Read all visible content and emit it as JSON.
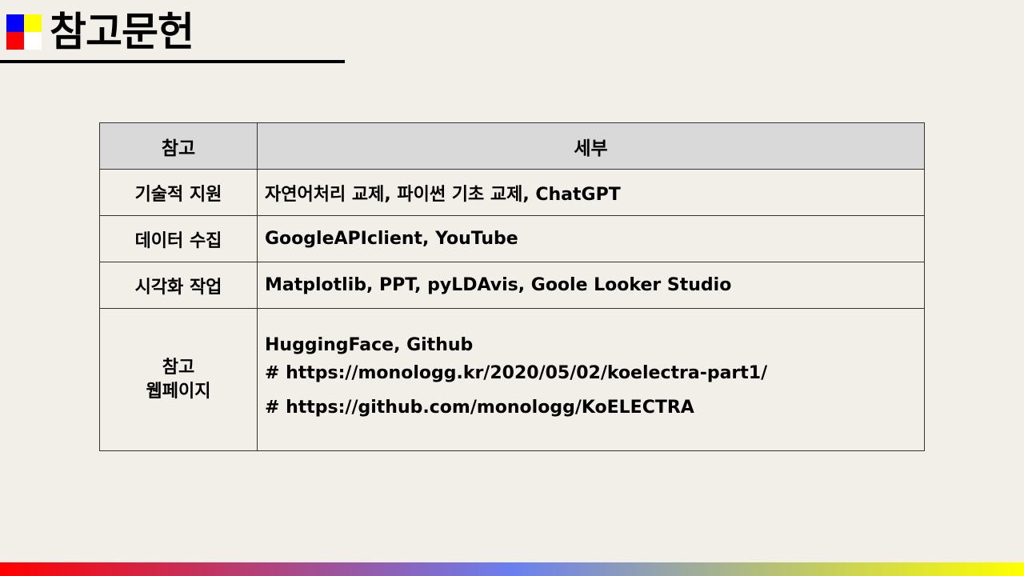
{
  "title": "참고문헌",
  "colors": {
    "background": "#f2efe9",
    "logo_top_left": "#0000ff",
    "logo_top_right": "#ffff00",
    "logo_bottom_left": "#ff0000",
    "logo_bottom_right": "#ffffff",
    "header_row": "#d9d9d9",
    "bottom_bar_gradient": [
      "#ff0000",
      "#6a7ff0",
      "#ffff00"
    ]
  },
  "table": {
    "headers": [
      "참고",
      "세부"
    ],
    "rows": [
      {
        "category": "기술적 지원",
        "detail": "자연어처리 교제, 파이썬 기초 교제, ChatGPT"
      },
      {
        "category": "데이터 수집",
        "detail": "GoogleAPIclient, YouTube"
      },
      {
        "category": "시각화 작업",
        "detail": "Matplotlib, PPT, pyLDAvis, Goole Looker Studio"
      },
      {
        "category_lines": [
          "참고",
          "웹페이지"
        ],
        "detail_lines": [
          "HuggingFace, Github",
          "# https://monologg.kr/2020/05/02/koelectra-part1/",
          "# https://github.com/monologg/KoELECTRA"
        ]
      }
    ]
  }
}
